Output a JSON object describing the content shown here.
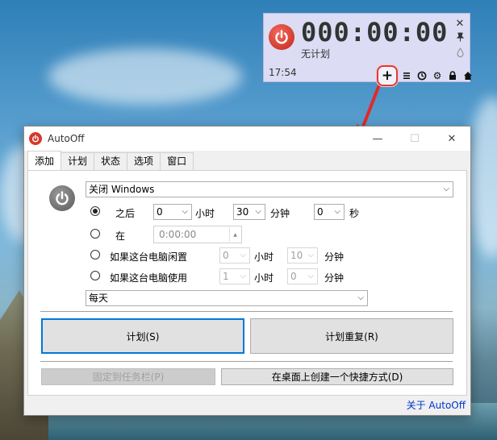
{
  "mini": {
    "clock": "000:00:00",
    "status": "无计划",
    "time": "17:54",
    "side_icons": [
      "close-icon",
      "pin-icon",
      "drop-icon"
    ],
    "toolbar_icons": [
      "plus-icon",
      "list-icon",
      "clock-icon",
      "gear-icon",
      "lock-icon",
      "home-icon"
    ]
  },
  "window": {
    "title": "AutoOff",
    "tabs": [
      "添加",
      "计划",
      "状态",
      "选项",
      "窗口"
    ],
    "action_select": "关闭 Windows",
    "rows": {
      "after": {
        "label": "之后",
        "hours": "0",
        "hours_unit": "小时",
        "minutes": "30",
        "minutes_unit": "分钟",
        "seconds": "0",
        "seconds_unit": "秒"
      },
      "at": {
        "label": "在",
        "time": "0:00:00"
      },
      "idle": {
        "label": "如果这台电脑闲置",
        "hours": "0",
        "hours_unit": "小时",
        "minutes": "10",
        "minutes_unit": "分钟"
      },
      "used": {
        "label": "如果这台电脑使用",
        "hours": "1",
        "hours_unit": "小时",
        "minutes": "0",
        "minutes_unit": "分钟"
      }
    },
    "repeat_select": "每天",
    "schedule_button": "计划(S)",
    "repeat_button": "计划重复(R)",
    "pin_button": "固定到任务栏(P)",
    "shortcut_button": "在桌面上创建一个快捷方式(D)",
    "about_link": "关于 AutoOff"
  },
  "colors": {
    "accent": "#0078d7",
    "power_red": "#d6382d",
    "highlight": "#e13a3a"
  }
}
